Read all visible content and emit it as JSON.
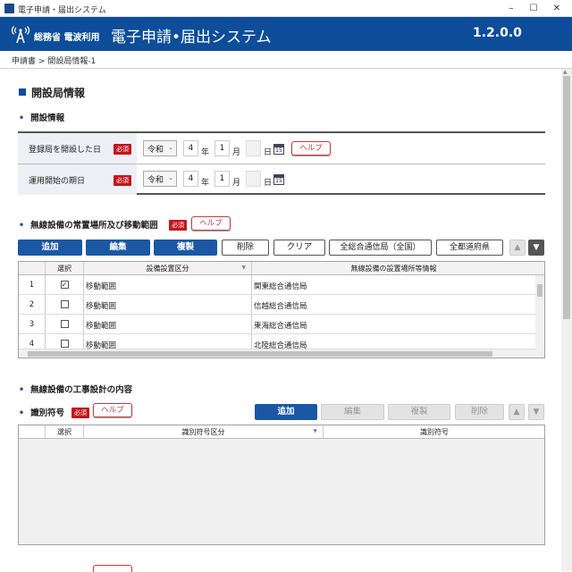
{
  "window": {
    "title": "電子申請・届出システム",
    "controls": [
      "–",
      "☐",
      "✕"
    ]
  },
  "header": {
    "org": "総務省 電波利用",
    "system": "電子申請•届出システム",
    "version": "1.2.0.0"
  },
  "breadcrumb": {
    "root": "申請書",
    "sep": ">",
    "current": "開設局情報-1"
  },
  "page": {
    "title": "開設局情報"
  },
  "section1": {
    "title": "開設情報",
    "rows": [
      {
        "label": "登録局を開設した日",
        "required": "必須",
        "era": "令和",
        "year": "4",
        "year_unit": "年",
        "month": "1",
        "month_unit": "月",
        "day": "",
        "day_unit": "日",
        "calendar": "15",
        "help": "ヘルプ"
      },
      {
        "label": "運用開始の期日",
        "required": "必須",
        "era": "令和",
        "year": "4",
        "year_unit": "年",
        "month": "1",
        "month_unit": "月",
        "day": "",
        "day_unit": "日",
        "calendar": "15"
      }
    ]
  },
  "section2": {
    "title": "無線設備の常置場所及び移動範囲",
    "required": "必須",
    "help": "ヘルプ",
    "toolbar": {
      "add": "追加",
      "edit": "編集",
      "copy": "複製",
      "delete": "削除",
      "clear": "クリア",
      "all_bureaus": "全総合通信局（全国）",
      "all_prefectures": "全都道府県",
      "up": "▲",
      "down": "▼"
    },
    "columns": [
      "",
      "選択",
      "設備設置区分",
      "無線設備の設置場所等情報"
    ],
    "rows": [
      {
        "no": "1",
        "checked": "✓",
        "type": "移動範囲",
        "info": "関東総合通信局"
      },
      {
        "no": "2",
        "checked": "",
        "type": "移動範囲",
        "info": "信越総合通信局"
      },
      {
        "no": "3",
        "checked": "",
        "type": "移動範囲",
        "info": "東海総合通信局"
      },
      {
        "no": "4",
        "checked": "",
        "type": "移動範囲",
        "info": "北陸総合通信局"
      }
    ]
  },
  "section3": {
    "title": "無線設備の工事設計の内容"
  },
  "section4": {
    "title": "識別符号",
    "required": "必須",
    "help": "ヘルプ",
    "toolbar": {
      "add": "追加",
      "edit": "編集",
      "copy": "複製",
      "delete": "削除",
      "up": "▲",
      "down": "▼"
    },
    "columns": [
      "",
      "選択",
      "識別符号区分",
      "識別符号"
    ]
  },
  "colors": {
    "brand": "#0d4d99",
    "primary_button": "#1b57a3",
    "required": "#c4151c",
    "help_border": "#c23a44"
  }
}
